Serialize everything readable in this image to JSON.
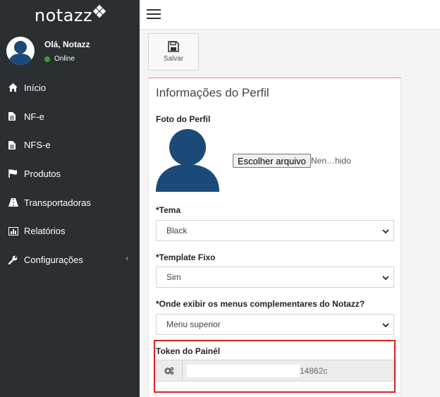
{
  "brand": {
    "name": "notazz"
  },
  "user": {
    "greeting": "Olá, Notazz",
    "status": "Online"
  },
  "sidebar": {
    "items": [
      {
        "label": "Início",
        "icon": "home-icon"
      },
      {
        "label": "NF-e",
        "icon": "file-icon"
      },
      {
        "label": "NFS-e",
        "icon": "file-icon"
      },
      {
        "label": "Produtos",
        "icon": "flag-icon"
      },
      {
        "label": "Transportadoras",
        "icon": "road-icon"
      },
      {
        "label": "Relatórios",
        "icon": "chart-icon"
      },
      {
        "label": "Configurações",
        "icon": "wrench-icon"
      }
    ]
  },
  "toolbar": {
    "save_label": "Salvar"
  },
  "profile": {
    "title": "Informações do Perfil",
    "photo_label": "Foto do Perfil",
    "file_button": "Escolher arquivo",
    "file_status": "Nen…hido",
    "theme_label": "*Tema",
    "theme_value": "Black",
    "template_label": "*Template Fixo",
    "template_value": "Sim",
    "menus_label": "*Onde exibir os menus complementares do Notazz?",
    "menus_value": "Menu superior",
    "token_label": "Token do Painél",
    "token_value": "14862c"
  },
  "colors": {
    "sidebar_bg": "#2b2f31",
    "avatar_blue": "#1b4a78",
    "highlight_red": "#d62020",
    "online_green": "#3c9a3c"
  }
}
